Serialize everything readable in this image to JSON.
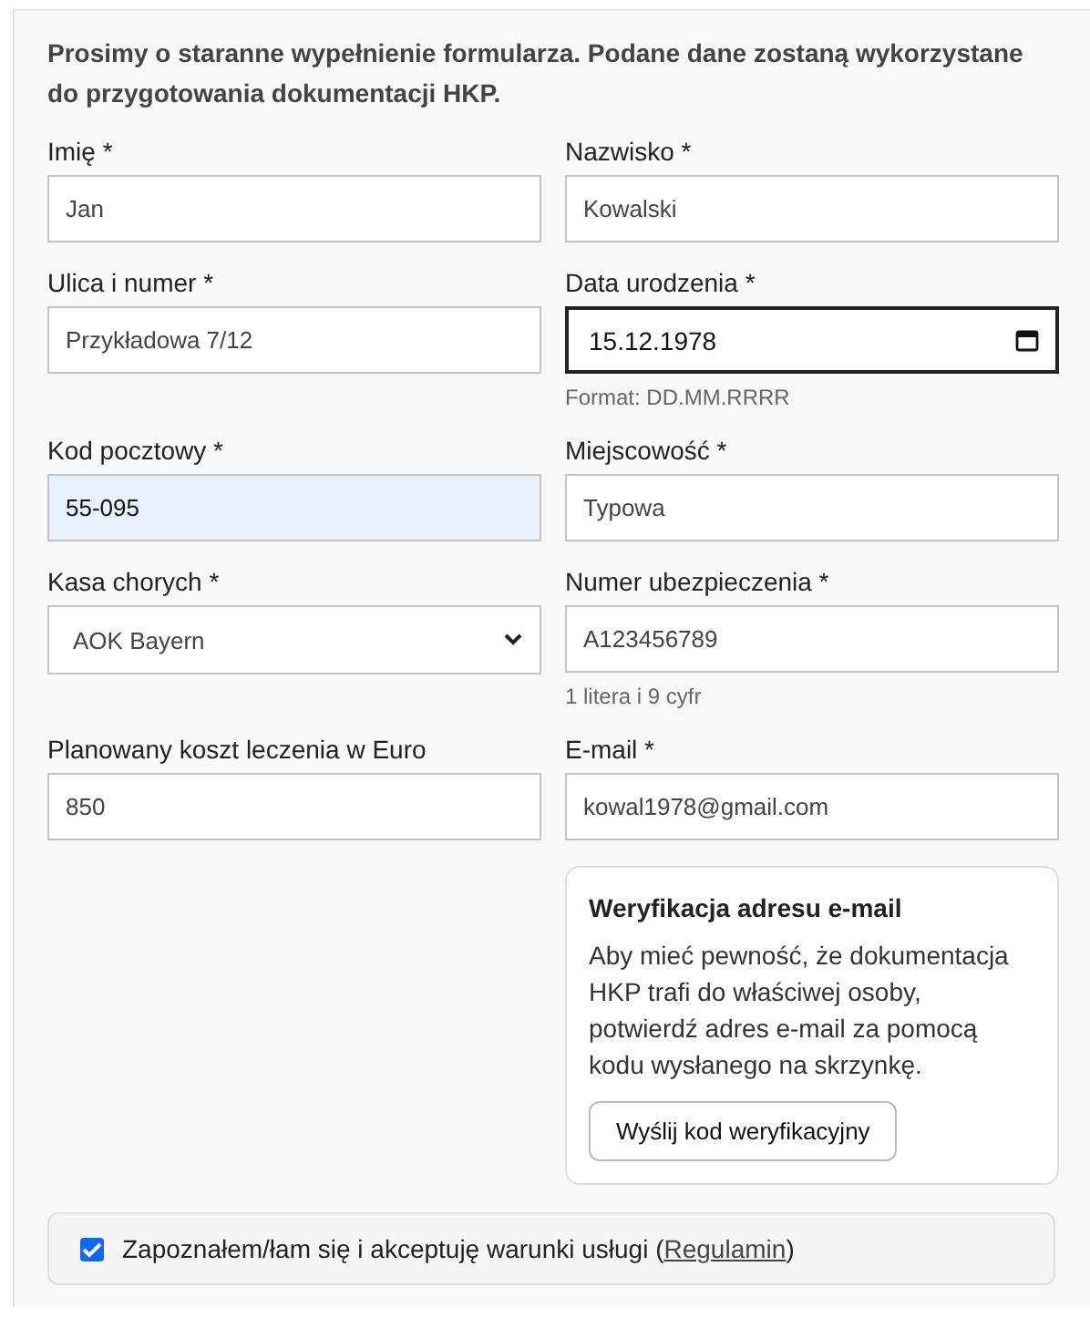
{
  "intro": "Prosimy o staranne wypełnienie formularza. Podane dane zostaną wykorzystane do przygotowania dokumentacji HKP.",
  "fields": [
    {
      "kind": "text",
      "label": "Imię *",
      "value": "Jan",
      "focused": false,
      "autofilled": false
    },
    {
      "kind": "text",
      "label": "Nazwisko *",
      "value": "Kowalski",
      "focused": false,
      "autofilled": false
    },
    {
      "kind": "text",
      "label": "Ulica i numer *",
      "value": "Przykładowa 7/12",
      "focused": false,
      "autofilled": false
    },
    {
      "kind": "date",
      "label": "Data urodzenia *",
      "value": "15.12.1978",
      "hint": "Format: DD.MM.RRRR",
      "focused": true,
      "autofilled": false
    },
    {
      "kind": "text",
      "label": "Kod pocztowy *",
      "value": "55-095",
      "focused": false,
      "autofilled": true
    },
    {
      "kind": "text",
      "label": "Miejscowość *",
      "value": "Typowa",
      "focused": false,
      "autofilled": false
    },
    {
      "kind": "select",
      "label": "Kasa chorych *",
      "value": "AOK Bayern",
      "focused": false,
      "autofilled": false
    },
    {
      "kind": "text",
      "label": "Numer ubezpieczenia *",
      "value": "A123456789",
      "hint": "1 litera i 9 cyfr",
      "focused": false,
      "autofilled": false
    },
    {
      "kind": "text",
      "label": "Planowany koszt leczenia w Euro",
      "value": "850",
      "focused": false,
      "autofilled": false
    },
    {
      "kind": "text",
      "label": "E-mail *",
      "value": "kowal1978@gmail.com",
      "focused": false,
      "autofilled": false
    }
  ],
  "verification": {
    "title": "Weryfikacja adresu e-mail",
    "text": "Aby mieć pewność, że dokumentacja HKP trafi do właściwej osoby, potwierdź adres e-mail za pomocą kodu wysłanego na skrzynkę.",
    "button": "Wyślij kod weryfikacyjny"
  },
  "agreement": {
    "checked": true,
    "text_before": "Zapoznałem/łam się i akceptuję warunki usługi (",
    "link": "Regulamin",
    "text_after": ")"
  }
}
